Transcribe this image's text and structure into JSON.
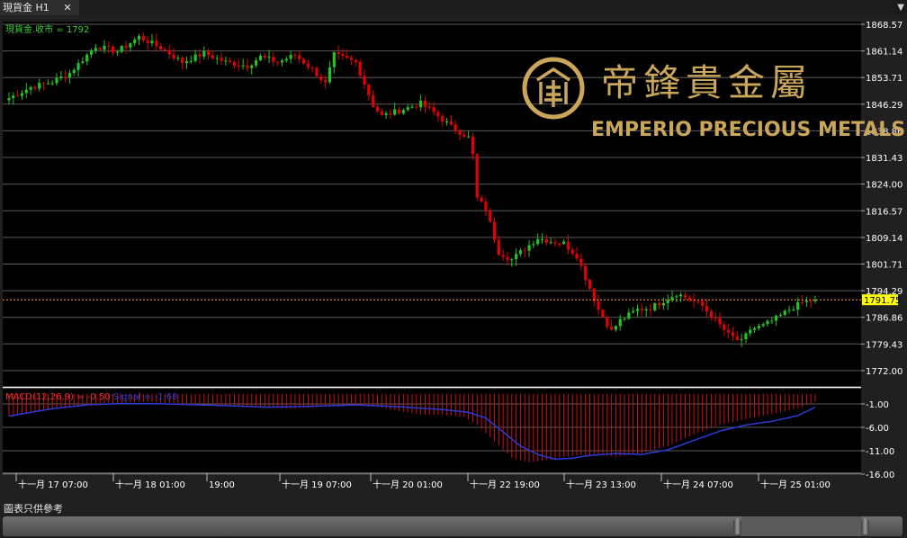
{
  "tab": {
    "title": "現貨金 H1",
    "close": "✕"
  },
  "menu_icon": "chevron-down-icon",
  "price_header": "現貨金.收市 = 1792",
  "macd_header": "MACD(12,26,9) = -0.50",
  "macd_signal_header": "Signal = -1.68",
  "watermark": {
    "cn": "帝鋒貴金屬",
    "en": "EMPERIO PRECIOUS METALS"
  },
  "footer_text": "圖表只供參考",
  "colors": {
    "bull": "#25c225",
    "bear": "#e30000",
    "price_line": "#ff9a2a",
    "signal": "#2c3ad6",
    "axis_text": "#ffffff",
    "price_label_bg": "#ffff00",
    "header_green": "#3ecf3e",
    "header_red": "#e83030",
    "gold": "#c9a65a"
  },
  "chart_data": [
    {
      "type": "candlestick",
      "title": "現貨金.收市 = 1792",
      "price_label": "1791.75",
      "yticks": [
        "1868.57",
        "1861.14",
        "1853.71",
        "1846.29",
        "1838.86",
        "1831.43",
        "1824.00",
        "1816.57",
        "1809.14",
        "1801.71",
        "1794.29",
        "1786.86",
        "1779.43",
        "1772.00"
      ],
      "ylim": [
        1772.0,
        1872.0
      ],
      "xticks": [
        "十一月 17 07:00",
        "十一月 18 01:00",
        "19:00",
        "十一月 19 07:00",
        "十一月 20 01:00",
        "十一月 22 19:00",
        "十一月 23 13:00",
        "十一月 24 07:00",
        "十一月 25 01:00"
      ],
      "last_close": 1791.75,
      "anchors": [
        [
          0,
          1848.0
        ],
        [
          5,
          1851.0
        ],
        [
          10,
          1852.5
        ],
        [
          14,
          1855.0
        ],
        [
          20,
          1862.5
        ],
        [
          25,
          1861.0
        ],
        [
          30,
          1865.0
        ],
        [
          35,
          1862.0
        ],
        [
          40,
          1858.0
        ],
        [
          45,
          1860.5
        ],
        [
          50,
          1858.0
        ],
        [
          55,
          1857.0
        ],
        [
          58,
          1859.5
        ],
        [
          62,
          1858.0
        ],
        [
          66,
          1860.0
        ],
        [
          70,
          1856.0
        ],
        [
          73,
          1852.0
        ],
        [
          75,
          1860.0
        ],
        [
          80,
          1858.0
        ],
        [
          82,
          1852.0
        ],
        [
          84,
          1846.0
        ],
        [
          86,
          1843.0
        ],
        [
          90,
          1844.5
        ],
        [
          95,
          1846.5
        ],
        [
          98,
          1844.0
        ],
        [
          102,
          1840.0
        ],
        [
          106,
          1837.0
        ],
        [
          107,
          1832.0
        ],
        [
          108,
          1820.0
        ],
        [
          110,
          1817.0
        ],
        [
          113,
          1805.0
        ],
        [
          116,
          1803.0
        ],
        [
          119,
          1806.0
        ],
        [
          122,
          1809.0
        ],
        [
          125,
          1808.0
        ],
        [
          128,
          1807.5
        ],
        [
          131,
          1804.0
        ],
        [
          134,
          1795.0
        ],
        [
          136,
          1789.0
        ],
        [
          139,
          1783.0
        ],
        [
          141,
          1786.0
        ],
        [
          145,
          1789.0
        ],
        [
          148,
          1789.5
        ],
        [
          151,
          1791.5
        ],
        [
          154,
          1793.5
        ],
        [
          157,
          1792.0
        ],
        [
          160,
          1790.0
        ],
        [
          163,
          1786.0
        ],
        [
          166,
          1782.0
        ],
        [
          169,
          1780.0
        ],
        [
          171,
          1783.5
        ],
        [
          174,
          1784.5
        ],
        [
          177,
          1786.5
        ],
        [
          180,
          1789.0
        ],
        [
          183,
          1791.0
        ],
        [
          186,
          1791.75
        ]
      ]
    },
    {
      "type": "histogram+line",
      "title": "MACD(12,26,9) = -0.50",
      "series": [
        {
          "name": "MACD(12,26,9)",
          "role": "histogram"
        },
        {
          "name": "Signal",
          "role": "line"
        }
      ],
      "yticks": [
        "-1.00",
        "-6.00",
        "-11.00",
        "-16.00"
      ],
      "ylim": [
        -16.8,
        1.5
      ],
      "macd_anchors": [
        [
          0,
          -3.6
        ],
        [
          10,
          -2.2
        ],
        [
          15,
          -1.4
        ],
        [
          22,
          -0.9
        ],
        [
          30,
          -0.5
        ],
        [
          40,
          -0.9
        ],
        [
          50,
          -1.2
        ],
        [
          60,
          -1.7
        ],
        [
          65,
          -2.0
        ],
        [
          72,
          -1.6
        ],
        [
          80,
          -1.2
        ],
        [
          85,
          -1.6
        ],
        [
          88,
          -2.2
        ],
        [
          95,
          -3.3
        ],
        [
          100,
          -3.3
        ],
        [
          105,
          -3.8
        ],
        [
          108,
          -5.5
        ],
        [
          112,
          -9.0
        ],
        [
          116,
          -12.5
        ],
        [
          120,
          -13.5
        ],
        [
          124,
          -13.0
        ],
        [
          128,
          -12.3
        ],
        [
          132,
          -12.0
        ],
        [
          136,
          -11.8
        ],
        [
          140,
          -12.3
        ],
        [
          146,
          -11.5
        ],
        [
          152,
          -10.0
        ],
        [
          158,
          -7.5
        ],
        [
          164,
          -5.5
        ],
        [
          170,
          -4.2
        ],
        [
          176,
          -3.2
        ],
        [
          182,
          -2.0
        ],
        [
          186,
          -0.5
        ]
      ],
      "signal_anchors": [
        [
          0,
          -3.6
        ],
        [
          10,
          -2.0
        ],
        [
          18,
          -1.2
        ],
        [
          26,
          -0.9
        ],
        [
          36,
          -1.0
        ],
        [
          48,
          -1.3
        ],
        [
          60,
          -1.7
        ],
        [
          70,
          -1.5
        ],
        [
          80,
          -1.2
        ],
        [
          90,
          -1.6
        ],
        [
          100,
          -2.2
        ],
        [
          106,
          -2.8
        ],
        [
          110,
          -4.0
        ],
        [
          114,
          -7.0
        ],
        [
          118,
          -10.0
        ],
        [
          122,
          -11.8
        ],
        [
          126,
          -12.8
        ],
        [
          130,
          -12.6
        ],
        [
          134,
          -12.0
        ],
        [
          140,
          -11.6
        ],
        [
          146,
          -11.8
        ],
        [
          152,
          -10.8
        ],
        [
          158,
          -8.8
        ],
        [
          164,
          -6.8
        ],
        [
          170,
          -5.5
        ],
        [
          176,
          -4.7
        ],
        [
          182,
          -3.5
        ],
        [
          186,
          -1.68
        ]
      ]
    }
  ]
}
